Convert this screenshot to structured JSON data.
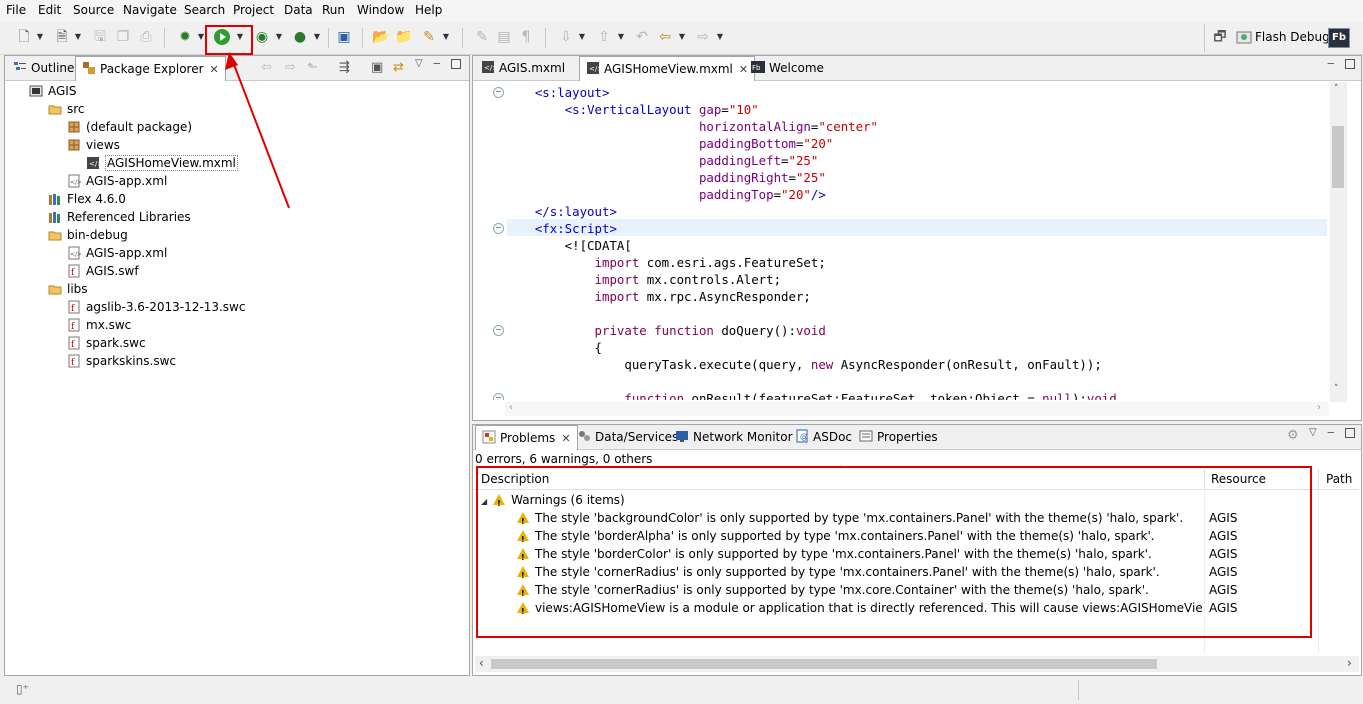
{
  "menu": [
    "File",
    "Edit",
    "Source",
    "Navigate",
    "Search",
    "Project",
    "Data",
    "Run",
    "Window",
    "Help"
  ],
  "perspective": {
    "label": "Flash Debug",
    "badge": "Fb"
  },
  "left_panel": {
    "tabs": [
      {
        "label": "Outline"
      },
      {
        "label": "Package Explorer"
      }
    ],
    "tree": [
      {
        "label": "AGIS",
        "icon": "project-icon",
        "depth": 0
      },
      {
        "label": "src",
        "icon": "folder-icon",
        "depth": 1
      },
      {
        "label": "(default package)",
        "icon": "package-icon",
        "depth": 2
      },
      {
        "label": "views",
        "icon": "package-icon",
        "depth": 2
      },
      {
        "label": "AGISHomeView.mxml",
        "icon": "mxml-file-icon",
        "depth": 3
      },
      {
        "label": "AGIS-app.xml",
        "icon": "xml-file-icon",
        "depth": 2
      },
      {
        "label": "Flex 4.6.0",
        "icon": "library-icon",
        "depth": 1
      },
      {
        "label": "Referenced Libraries",
        "icon": "library-icon",
        "depth": 1
      },
      {
        "label": "bin-debug",
        "icon": "folder-icon",
        "depth": 1
      },
      {
        "label": "AGIS-app.xml",
        "icon": "xml-file-icon",
        "depth": 2
      },
      {
        "label": "AGIS.swf",
        "icon": "swf-file-icon",
        "depth": 2
      },
      {
        "label": "libs",
        "icon": "folder-icon",
        "depth": 1
      },
      {
        "label": "agslib-3.6-2013-12-13.swc",
        "icon": "swc-file-icon",
        "depth": 2
      },
      {
        "label": "mx.swc",
        "icon": "swc-file-icon",
        "depth": 2
      },
      {
        "label": "spark.swc",
        "icon": "swc-file-icon",
        "depth": 2
      },
      {
        "label": "sparkskins.swc",
        "icon": "swc-file-icon",
        "depth": 2
      }
    ]
  },
  "editor": {
    "tabs": [
      {
        "label": "AGIS.mxml"
      },
      {
        "label": "AGISHomeView.mxml"
      },
      {
        "label": "Welcome"
      }
    ],
    "lines": [
      {
        "fold": true,
        "parts": [
          [
            "plain",
            "    "
          ],
          [
            "tag",
            "<s:layout>"
          ]
        ]
      },
      {
        "fold": false,
        "parts": [
          [
            "plain",
            "        "
          ],
          [
            "tag",
            "<s:VerticalLayout "
          ],
          [
            "attr",
            "gap"
          ],
          [
            "plain",
            "="
          ],
          [
            "val",
            "\"10\""
          ]
        ]
      },
      {
        "fold": false,
        "parts": [
          [
            "plain",
            "                          "
          ],
          [
            "attr",
            "horizontalAlign"
          ],
          [
            "plain",
            "="
          ],
          [
            "val",
            "\"center\""
          ]
        ]
      },
      {
        "fold": false,
        "parts": [
          [
            "plain",
            "                          "
          ],
          [
            "attr",
            "paddingBottom"
          ],
          [
            "plain",
            "="
          ],
          [
            "val",
            "\"20\""
          ]
        ]
      },
      {
        "fold": false,
        "parts": [
          [
            "plain",
            "                          "
          ],
          [
            "attr",
            "paddingLeft"
          ],
          [
            "plain",
            "="
          ],
          [
            "val",
            "\"25\""
          ]
        ]
      },
      {
        "fold": false,
        "parts": [
          [
            "plain",
            "                          "
          ],
          [
            "attr",
            "paddingRight"
          ],
          [
            "plain",
            "="
          ],
          [
            "val",
            "\"25\""
          ]
        ]
      },
      {
        "fold": false,
        "parts": [
          [
            "plain",
            "                          "
          ],
          [
            "attr",
            "paddingTop"
          ],
          [
            "plain",
            "="
          ],
          [
            "val",
            "\"20\""
          ],
          [
            "tag",
            "/>"
          ]
        ]
      },
      {
        "fold": false,
        "parts": [
          [
            "plain",
            "    "
          ],
          [
            "tag",
            "</s:layout>"
          ]
        ]
      },
      {
        "fold": true,
        "parts": [
          [
            "plain",
            "    "
          ],
          [
            "tag",
            "<fx:Script>"
          ]
        ]
      },
      {
        "fold": false,
        "parts": [
          [
            "plain",
            "        <![CDATA["
          ]
        ]
      },
      {
        "fold": false,
        "parts": [
          [
            "plain",
            "            "
          ],
          [
            "kw",
            "import"
          ],
          [
            "plain",
            " com.esri.ags.FeatureSet;"
          ]
        ]
      },
      {
        "fold": false,
        "parts": [
          [
            "plain",
            "            "
          ],
          [
            "kw",
            "import"
          ],
          [
            "plain",
            " mx.controls.Alert;"
          ]
        ]
      },
      {
        "fold": false,
        "parts": [
          [
            "plain",
            "            "
          ],
          [
            "kw",
            "import"
          ],
          [
            "plain",
            " mx.rpc.AsyncResponder;"
          ]
        ]
      },
      {
        "fold": false,
        "parts": [
          [
            "plain",
            ""
          ]
        ]
      },
      {
        "fold": true,
        "parts": [
          [
            "plain",
            "            "
          ],
          [
            "kw",
            "private function"
          ],
          [
            "plain",
            " doQuery():"
          ],
          [
            "kw",
            "void"
          ]
        ]
      },
      {
        "fold": false,
        "parts": [
          [
            "plain",
            "            {"
          ]
        ]
      },
      {
        "fold": false,
        "parts": [
          [
            "plain",
            "                queryTask.execute(query, "
          ],
          [
            "kw",
            "new"
          ],
          [
            "plain",
            " AsyncResponder(onResult, onFault));"
          ]
        ]
      },
      {
        "fold": false,
        "parts": [
          [
            "plain",
            ""
          ]
        ]
      },
      {
        "fold": true,
        "parts": [
          [
            "plain",
            "                "
          ],
          [
            "kw",
            "function"
          ],
          [
            "plain",
            " onResult(featureSet:FeatureSet, token:Object = "
          ],
          [
            "kw",
            "null"
          ],
          [
            "plain",
            "):"
          ],
          [
            "kw",
            "void"
          ]
        ]
      }
    ]
  },
  "bottom_panel": {
    "tabs": [
      {
        "label": "Problems"
      },
      {
        "label": "Data/Services"
      },
      {
        "label": "Network Monitor"
      },
      {
        "label": "ASDoc"
      },
      {
        "label": "Properties"
      }
    ],
    "summary": "0 errors, 6 warnings, 0 others",
    "columns": [
      "Description",
      "Resource",
      "Path"
    ],
    "group_label": "Warnings (6 items)",
    "rows": [
      {
        "description": "The style 'backgroundColor' is only supported by type 'mx.containers.Panel' with the theme(s) 'halo, spark'.",
        "resource": "AGIS"
      },
      {
        "description": "The style 'borderAlpha' is only supported by type 'mx.containers.Panel' with the theme(s) 'halo, spark'.",
        "resource": "AGIS"
      },
      {
        "description": "The style 'borderColor' is only supported by type 'mx.containers.Panel' with the theme(s) 'halo, spark'.",
        "resource": "AGIS"
      },
      {
        "description": "The style 'cornerRadius' is only supported by type 'mx.containers.Panel' with the theme(s) 'halo, spark'.",
        "resource": "AGIS"
      },
      {
        "description": "The style 'cornerRadius' is only supported by type 'mx.core.Container' with the theme(s) 'halo, spark'.",
        "resource": "AGIS"
      },
      {
        "description": "views:AGISHomeView is a module or application that is directly referenced. This will cause views:AGISHomeView and all of its d",
        "resource": "AGIS"
      }
    ]
  },
  "colors": {
    "highlight": "#e00000",
    "tag": "#0000c8",
    "attr": "#7a0080",
    "value": "#c80000",
    "keyword": "#7f0055",
    "warning": "#e8b400"
  }
}
